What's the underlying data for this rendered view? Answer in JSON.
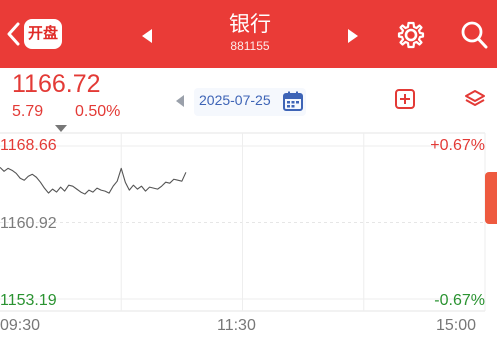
{
  "header": {
    "back_icon": "chevron-left-icon",
    "open_button_label": "开盘",
    "title": "银行",
    "code": "881155",
    "prev_icon": "triangle-left-icon",
    "next_icon": "triangle-right-icon",
    "settings_icon": "gear-icon",
    "search_icon": "search-icon"
  },
  "quote": {
    "price": "1166.72",
    "change": "5.79",
    "change_pct": "0.50%",
    "date": "2025-07-25",
    "date_prev_icon": "triangle-left-icon",
    "calendar_icon": "calendar-icon",
    "add_icon": "add-icon",
    "layers_icon": "layers-icon"
  },
  "colors": {
    "brand": "#ea3b37",
    "up": "#e33a36",
    "down": "#2a9331",
    "neutral": "#7b7b7b",
    "accent_date": "#3e64b6"
  },
  "chart_data": {
    "type": "line",
    "title": "",
    "xlabel": "",
    "ylabel": "",
    "price_labels": {
      "high": "1168.66",
      "mid": "1160.92",
      "low": "1153.19"
    },
    "pct_labels": {
      "high": "+0.67%",
      "low": "-0.67%"
    },
    "x_ticks": [
      "09:30",
      "11:30",
      "15:00"
    ],
    "ylim": [
      1153.19,
      1168.66
    ],
    "x_session_minutes": [
      0,
      240
    ],
    "series": [
      {
        "x": [
          0,
          2,
          4,
          6,
          8,
          10,
          12,
          14,
          16,
          18,
          20,
          22,
          24,
          26,
          28,
          30,
          32,
          34,
          36,
          38,
          40,
          42,
          44,
          46,
          48,
          50,
          52,
          54,
          56,
          58,
          60,
          62,
          64,
          66,
          68,
          70,
          72,
          74,
          76,
          78,
          80,
          82,
          84,
          86,
          88,
          90,
          92
        ],
        "values": [
          1166.5,
          1166.1,
          1166.4,
          1166.2,
          1165.9,
          1165.4,
          1165.2,
          1165.6,
          1165.8,
          1165.5,
          1165.0,
          1164.4,
          1163.9,
          1164.3,
          1164.0,
          1164.5,
          1164.1,
          1164.7,
          1164.6,
          1164.3,
          1164.0,
          1163.8,
          1164.2,
          1164.0,
          1164.4,
          1164.2,
          1164.1,
          1163.9,
          1164.6,
          1165.1,
          1166.4,
          1165.0,
          1164.2,
          1164.7,
          1164.3,
          1164.6,
          1164.1,
          1164.5,
          1164.4,
          1164.3,
          1164.6,
          1165.0,
          1164.9,
          1165.3,
          1165.2,
          1165.1,
          1166.0
        ]
      }
    ],
    "grid": true
  }
}
